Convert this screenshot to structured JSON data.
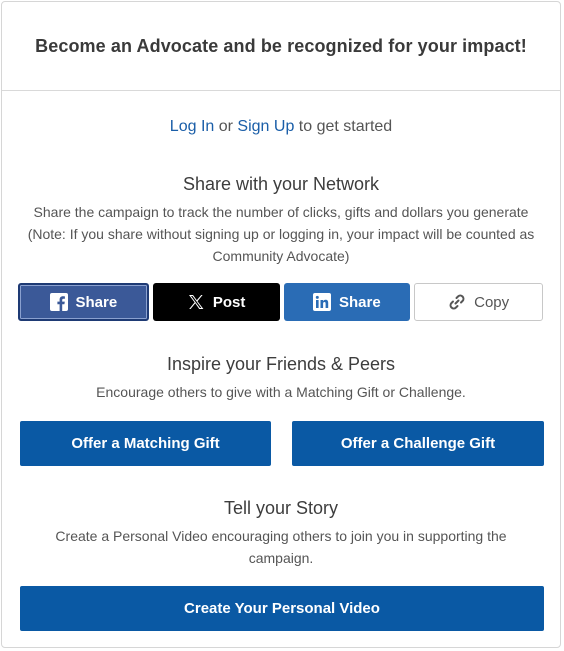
{
  "header": {
    "title": "Become an Advocate and be recognized for your impact!"
  },
  "auth": {
    "login": "Log In",
    "or": "or",
    "signup": "Sign Up",
    "suffix": "to get started"
  },
  "network": {
    "title": "Share with your Network",
    "desc": "Share the campaign to track the number of clicks, gifts and dollars you generate (Note: If you share without signing up or logging in, your impact will be counted as Community Advocate)",
    "buttons": {
      "facebook": "Share",
      "x": "Post",
      "linkedin": "Share",
      "copy": "Copy"
    }
  },
  "inspire": {
    "title": "Inspire your Friends & Peers",
    "desc": "Encourage others to give with a Matching Gift or Challenge.",
    "matching": "Offer a Matching Gift",
    "challenge": "Offer a Challenge Gift"
  },
  "story": {
    "title": "Tell your Story",
    "desc": "Create a Personal Video encouraging others to join you in supporting the campaign.",
    "video": "Create Your Personal Video"
  },
  "icons": {
    "facebook": "facebook-icon",
    "x": "x-logo-icon",
    "linkedin": "linkedin-icon",
    "copy": "link-icon"
  },
  "colors": {
    "link": "#1a5ea8",
    "primary": "#0a59a4",
    "facebook": "#3b5998",
    "linkedin": "#2a6cb5",
    "x": "#000000"
  }
}
